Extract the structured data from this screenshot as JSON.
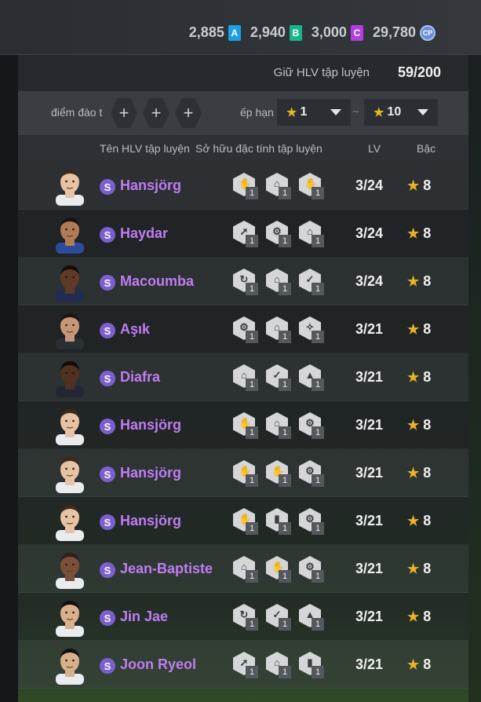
{
  "currencies": [
    {
      "amount": "2,885",
      "letter": "A",
      "color": "#1aa0e8"
    },
    {
      "amount": "2,940",
      "letter": "B",
      "color": "#18b58c"
    },
    {
      "amount": "3,000",
      "letter": "C",
      "color": "#b13fe0"
    },
    {
      "amount": "29,780",
      "letter": "CP",
      "color": "#6a8dd8"
    }
  ],
  "keep": {
    "label": "Giữ HLV tập luyện",
    "value": "59/200"
  },
  "filter": {
    "label1": "điểm đào t",
    "plus": "+",
    "label2": "ếp hạn",
    "min": "1",
    "max": "10",
    "tilde": "~"
  },
  "columns": {
    "name": "Tên HLV tập luyện",
    "traits": "Sở hữu đặc tính tập luyện",
    "lv": "LV",
    "grade": "Bậc"
  },
  "accent": {
    "name": "#c07cf3",
    "star": "#e8b426",
    "badge": "#7b5fd1"
  },
  "players": [
    {
      "name": "Hansjörg",
      "lv": "3/24",
      "grade": "8",
      "skin": "#e8c2a4",
      "hair": "#3a2a1e",
      "shirt": "#e9ecef",
      "traits": [
        "✋",
        "⌂",
        "✋"
      ]
    },
    {
      "name": "Haydar",
      "lv": "3/24",
      "grade": "8",
      "skin": "#b07b55",
      "hair": "#1a1410",
      "shirt": "#2c4b9a",
      "traits": [
        "➚",
        "⚙",
        "⌂"
      ]
    },
    {
      "name": "Macoumba",
      "lv": "3/24",
      "grade": "8",
      "skin": "#5c3a26",
      "hair": "#140e0a",
      "shirt": "#1f2c55",
      "traits": [
        "↻",
        "⌂",
        "✓"
      ]
    },
    {
      "name": "Aşık",
      "lv": "3/21",
      "grade": "8",
      "skin": "#c59776",
      "hair": "#1e1610",
      "shirt": "#2a2f35",
      "traits": [
        "⚙",
        "⌂",
        "✧"
      ]
    },
    {
      "name": "Diafra",
      "lv": "3/21",
      "grade": "8",
      "skin": "#4e3120",
      "hair": "#120c08",
      "shirt": "#222733",
      "traits": [
        "⌂",
        "✓",
        "▲"
      ]
    },
    {
      "name": "Hansjörg",
      "lv": "3/21",
      "grade": "8",
      "skin": "#e8c2a4",
      "hair": "#3a2a1e",
      "shirt": "#e9ecef",
      "traits": [
        "✋",
        "⌂",
        "⚙"
      ]
    },
    {
      "name": "Hansjörg",
      "lv": "3/21",
      "grade": "8",
      "skin": "#e8c2a4",
      "hair": "#3a2a1e",
      "shirt": "#e9ecef",
      "traits": [
        "✋",
        "✋",
        "⚙"
      ]
    },
    {
      "name": "Hansjörg",
      "lv": "3/21",
      "grade": "8",
      "skin": "#e8c2a4",
      "hair": "#3a2a1e",
      "shirt": "#e9ecef",
      "traits": [
        "✋",
        "▮",
        "⚙"
      ]
    },
    {
      "name": "Jean-Baptiste",
      "lv": "3/21",
      "grade": "8",
      "skin": "#7a5038",
      "hair": "#2b201a",
      "shirt": "#e9ecef",
      "traits": [
        "⌂",
        "✋",
        "⚙"
      ]
    },
    {
      "name": "Jin Jae",
      "lv": "3/21",
      "grade": "8",
      "skin": "#d9b08c",
      "hair": "#141010",
      "shirt": "#e9ecef",
      "traits": [
        "↻",
        "✓",
        "▲"
      ]
    },
    {
      "name": "Joon Ryeol",
      "lv": "3/21",
      "grade": "8",
      "skin": "#d9b08c",
      "hair": "#141010",
      "shirt": "#e9ecef",
      "traits": [
        "➚",
        "⌂",
        "▮"
      ]
    }
  ],
  "trait_level": "1"
}
